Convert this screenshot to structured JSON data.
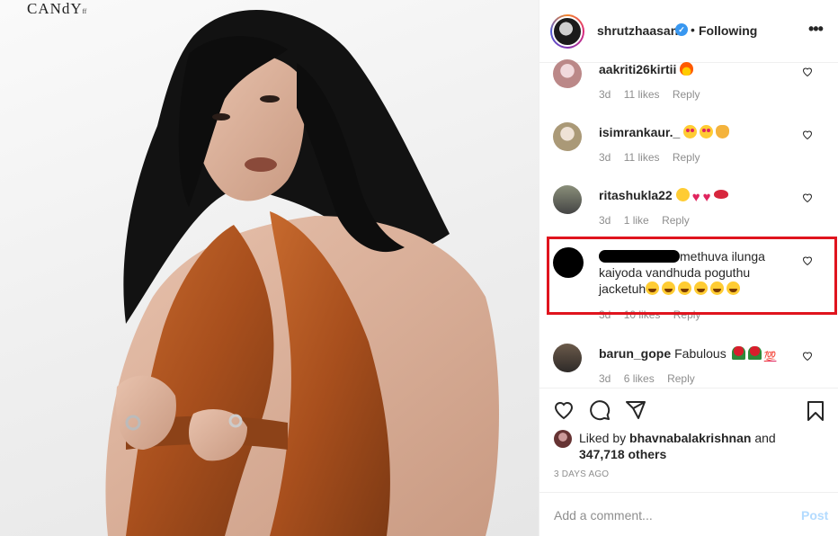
{
  "photo": {
    "watermark": "CANdY",
    "watermark_small": "ff"
  },
  "post_header": {
    "username": "shrutzhaasan",
    "separator": "•",
    "follow_status": "Following",
    "more_icon": "more-icon"
  },
  "comments": [
    {
      "username": "aakriti26kirtii",
      "text": "",
      "emojis": [
        "fire"
      ],
      "age": "3d",
      "likes": "11 likes",
      "reply": "Reply"
    },
    {
      "username": "isimrankaur._",
      "text": "",
      "emojis": [
        "heart-eyes",
        "heart-eyes",
        "clap"
      ],
      "age": "3d",
      "likes": "11 likes",
      "reply": "Reply"
    },
    {
      "username": "ritashukla22",
      "text": "",
      "emojis": [
        "smile",
        "heart",
        "heart",
        "lips"
      ],
      "age": "3d",
      "likes": "1 like",
      "reply": "Reply"
    },
    {
      "username": "",
      "text": "methuva ilunga kaiyoda vandhuda poguthu jacketuh",
      "emojis": [
        "joy",
        "joy",
        "joy",
        "joy",
        "joy",
        "joy"
      ],
      "age": "3d",
      "likes": "10 likes",
      "reply": "Reply",
      "redacted_username": true
    },
    {
      "username": "barun_gope",
      "text": "Fabulous",
      "emojis": [
        "rose",
        "rose",
        "hundred"
      ],
      "age": "3d",
      "likes": "6 likes",
      "reply": "Reply"
    }
  ],
  "actions": {
    "like_icon": "heart-icon",
    "comment_icon": "comment-icon",
    "share_icon": "send-icon",
    "save_icon": "bookmark-icon"
  },
  "likes": {
    "prefix": "Liked by",
    "user": "bhavnabalakrishnan",
    "conjunction": "and",
    "others": "347,718 others"
  },
  "timestamp": "3 DAYS AGO",
  "add_comment": {
    "placeholder": "Add a comment...",
    "post_label": "Post"
  },
  "colors": {
    "highlight_border": "#e0141e",
    "verified_badge": "#3897f0",
    "post_button_disabled": "#b3dbff",
    "dress": "#b85a24"
  }
}
